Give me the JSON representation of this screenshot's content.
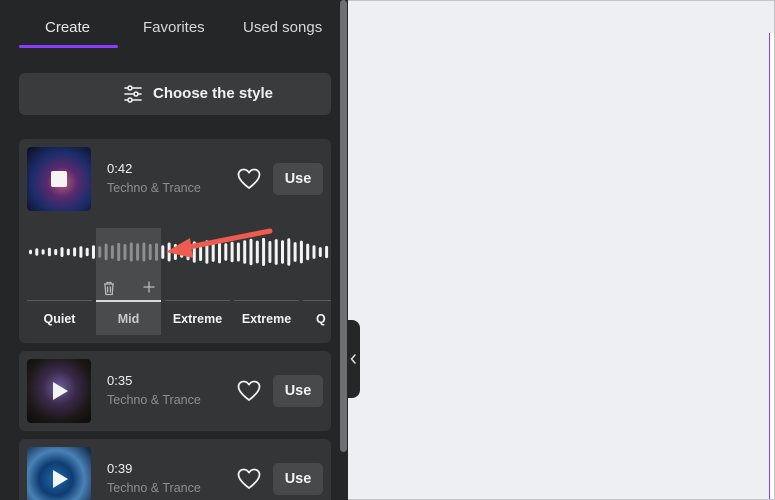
{
  "tabs": [
    {
      "label": "Create",
      "active": true
    },
    {
      "label": "Favorites",
      "active": false
    },
    {
      "label": "Used songs",
      "active": false
    }
  ],
  "style_button": {
    "label": "Choose the style",
    "icon": "sliders-icon"
  },
  "songs": [
    {
      "duration": "0:42",
      "genre": "Techno & Trance",
      "state": "playing",
      "use_label": "Use",
      "favorite": false
    },
    {
      "duration": "0:35",
      "genre": "Techno & Trance",
      "state": "paused",
      "use_label": "Use",
      "favorite": false
    },
    {
      "duration": "0:39",
      "genre": "Techno & Trance",
      "state": "paused",
      "use_label": "Use",
      "favorite": false
    }
  ],
  "segments": [
    {
      "label": "Quiet",
      "selected": false
    },
    {
      "label": "Mid",
      "selected": true
    },
    {
      "label": "Extreme",
      "selected": false
    },
    {
      "label": "Extreme",
      "selected": false
    },
    {
      "label": "Q",
      "selected": false
    }
  ],
  "waveform": {
    "amplitudes": [
      0.12,
      0.2,
      0.14,
      0.22,
      0.16,
      0.26,
      0.18,
      0.24,
      0.3,
      0.22,
      0.36,
      0.3,
      0.44,
      0.36,
      0.48,
      0.42,
      0.5,
      0.46,
      0.5,
      0.42,
      0.46,
      0.36,
      0.5,
      0.42,
      0.3,
      0.44,
      0.56,
      0.48,
      0.62,
      0.52,
      0.6,
      0.46,
      0.54,
      0.5,
      0.62,
      0.7,
      0.6,
      0.74,
      0.58,
      0.68,
      0.62,
      0.72,
      0.52,
      0.6,
      0.44,
      0.36,
      0.26,
      0.32,
      0.2
    ]
  },
  "colors": {
    "accent": "#8b3dff",
    "arrow": "#ee5b4f",
    "panel": "#252627",
    "card": "#343537"
  }
}
